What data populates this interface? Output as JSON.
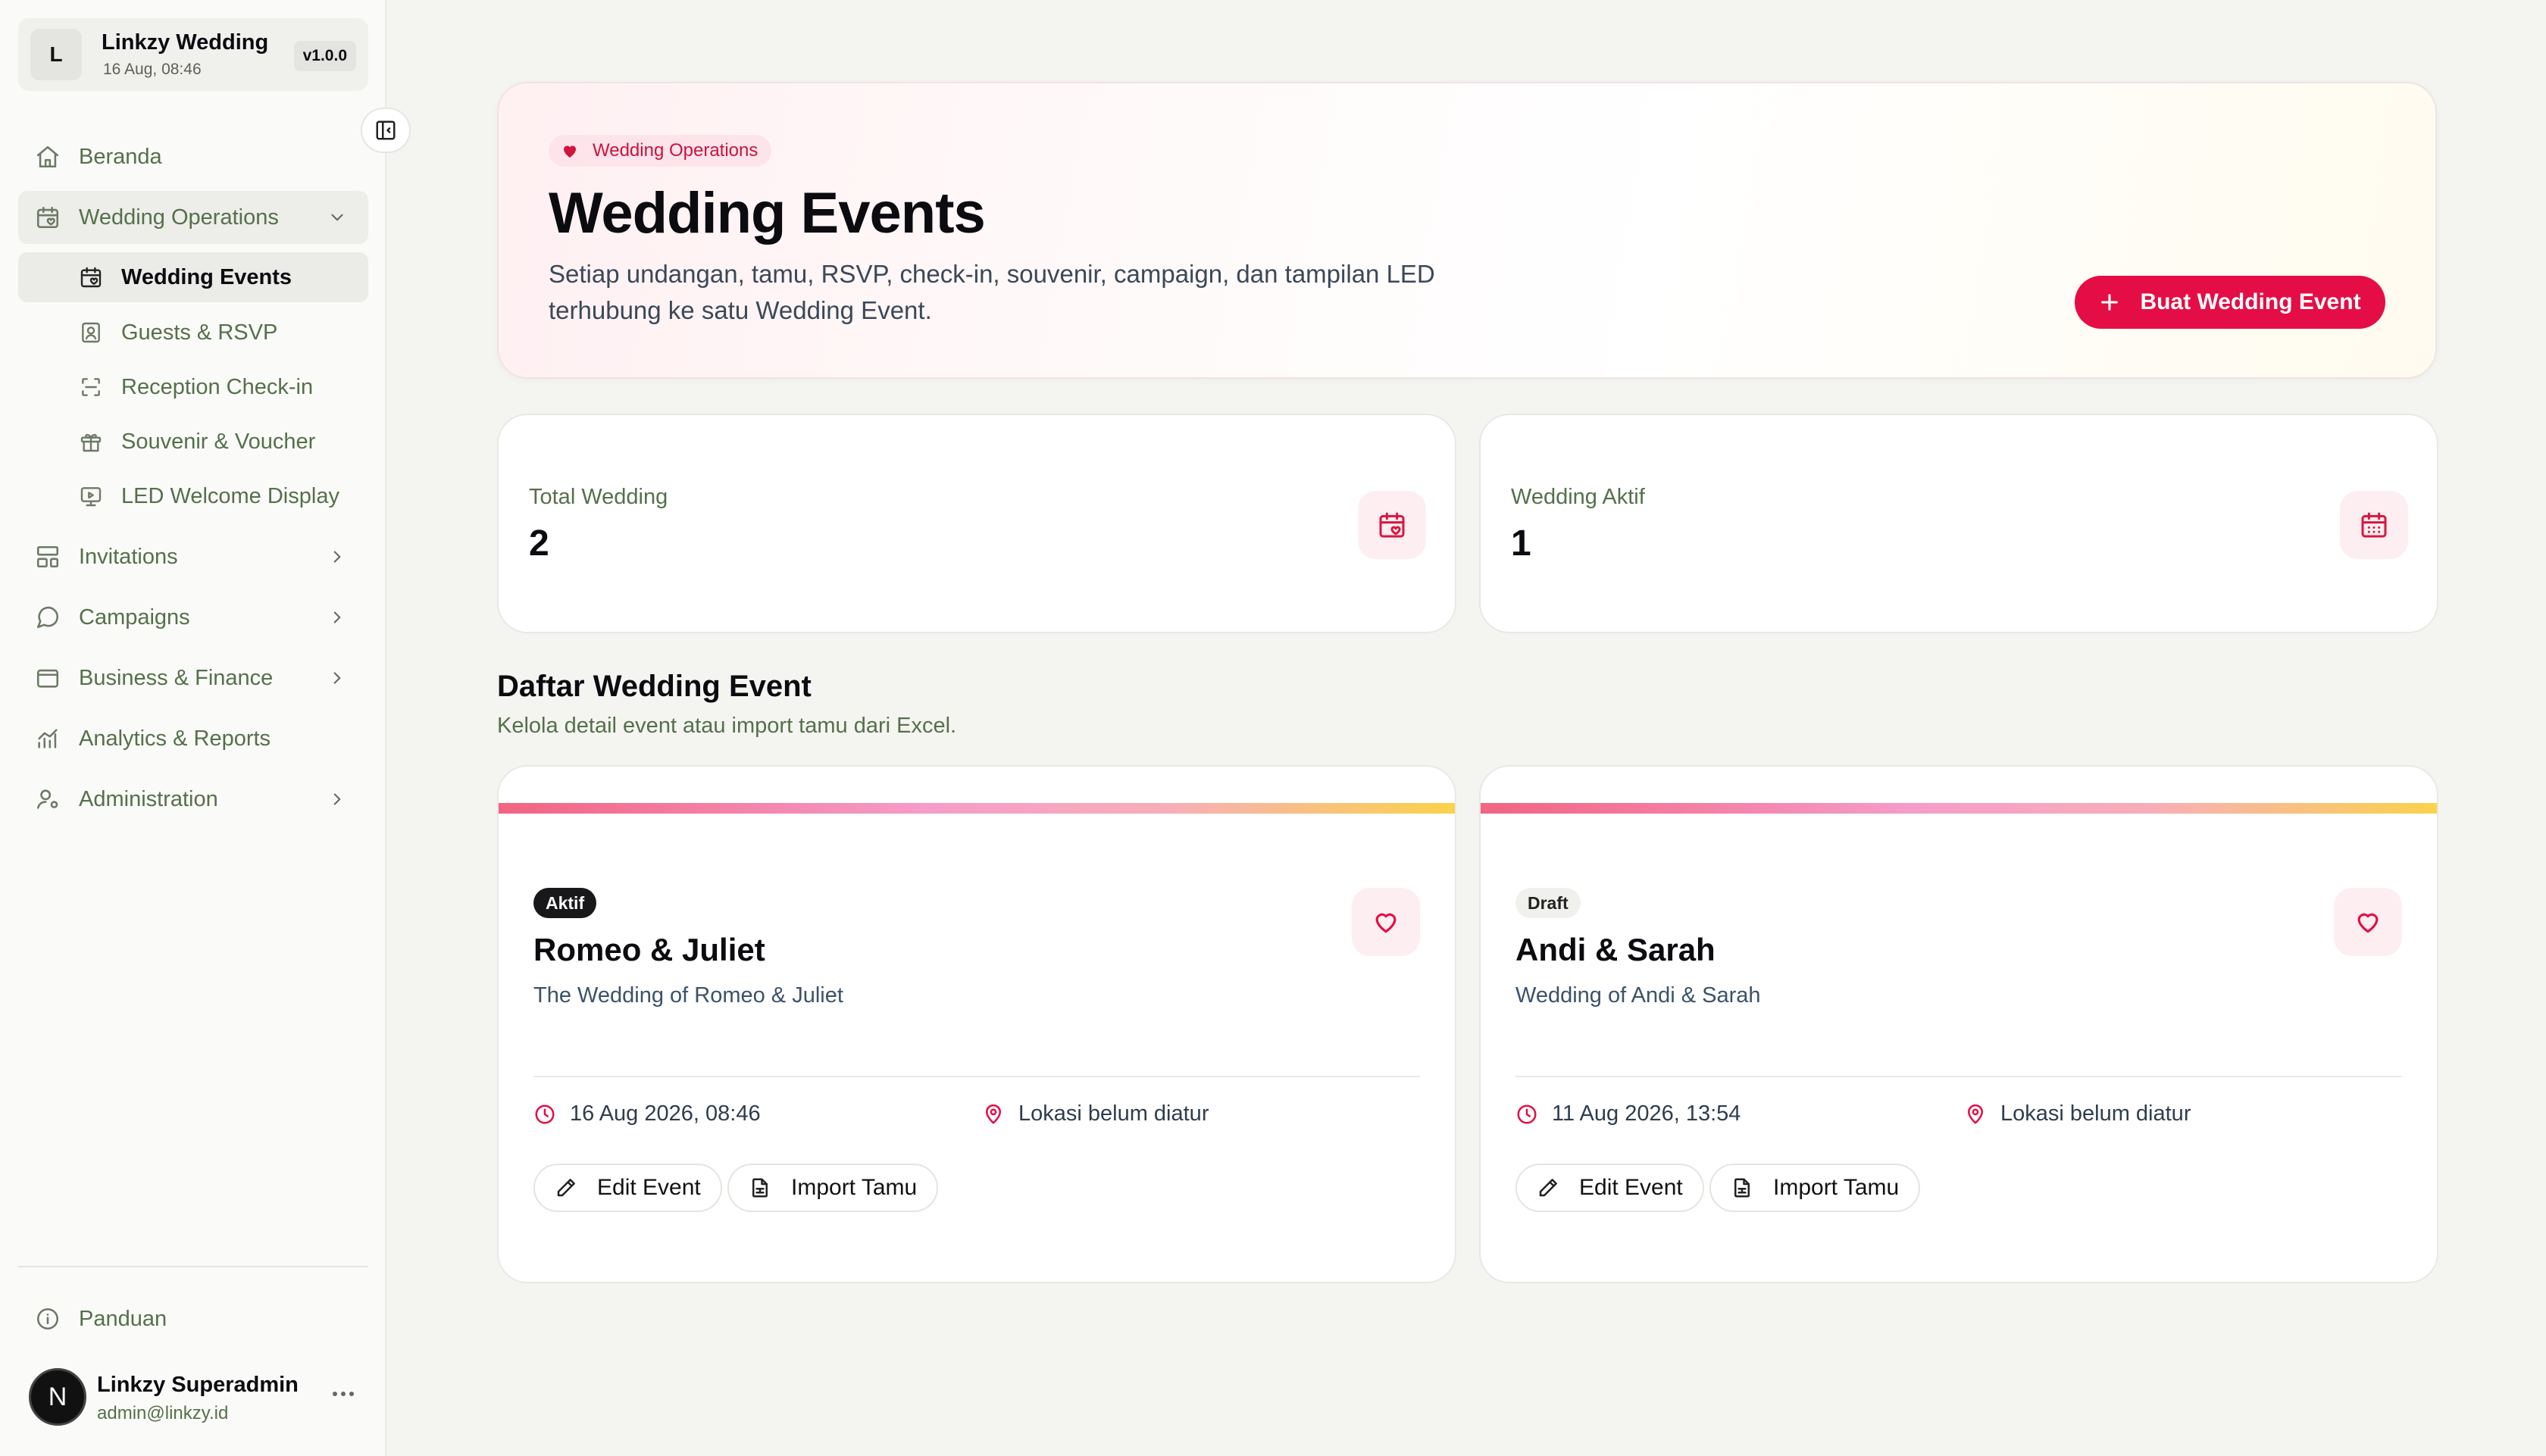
{
  "sidebar": {
    "brand": {
      "logo_letter": "L",
      "name": "Linkzy Wedding",
      "date": "16 Aug, 08:46",
      "version": "v1.0.0"
    },
    "nav": {
      "beranda": "Beranda",
      "wedding_operations": "Wedding Operations",
      "sub": {
        "wedding_events": "Wedding Events",
        "guests_rsvp": "Guests & RSVP",
        "reception_checkin": "Reception Check-in",
        "souvenir_voucher": "Souvenir & Voucher",
        "led_display": "LED Welcome Display"
      },
      "invitations": "Invitations",
      "campaigns": "Campaigns",
      "business_finance": "Business & Finance",
      "analytics_reports": "Analytics & Reports",
      "administration": "Administration",
      "panduan": "Panduan"
    },
    "user": {
      "avatar_letter": "N",
      "name": "Linkzy Superadmin",
      "email": "admin@linkzy.id"
    }
  },
  "hero": {
    "badge": "Wedding Operations",
    "title": "Wedding Events",
    "description": "Setiap undangan, tamu, RSVP, check-in, souvenir, campaign, dan tampilan LED terhubung ke satu Wedding Event.",
    "primary_button": "Buat Wedding Event"
  },
  "stats": {
    "total": {
      "label": "Total Wedding",
      "value": "2"
    },
    "active": {
      "label": "Wedding Aktif",
      "value": "1"
    }
  },
  "section": {
    "title": "Daftar Wedding Event",
    "subtitle": "Kelola detail event atau import tamu dari Excel."
  },
  "events": [
    {
      "status": "Aktif",
      "title": "Romeo & Juliet",
      "subtitle": "The Wedding of Romeo & Juliet",
      "datetime": "16 Aug 2026, 08:46",
      "location": "Lokasi belum diatur",
      "edit_label": "Edit Event",
      "import_label": "Import Tamu"
    },
    {
      "status": "Draft",
      "title": "Andi & Sarah",
      "subtitle": "Wedding of Andi & Sarah",
      "datetime": "11 Aug 2026, 13:54",
      "location": "Lokasi belum diatur",
      "edit_label": "Edit Event",
      "import_label": "Import Tamu"
    }
  ],
  "colors": {
    "accent": "#e50d45",
    "accent_soft": "#fdeef1",
    "nav_text": "#55704b"
  }
}
